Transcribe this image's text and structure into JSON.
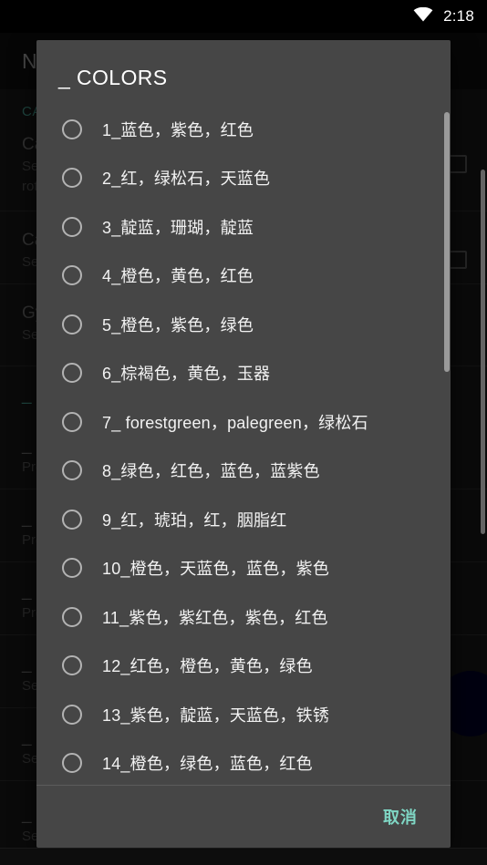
{
  "status_bar": {
    "wifi_icon": "wifi-icon",
    "time": "2:18"
  },
  "background_app": {
    "header_title": "NE",
    "section_title": "CA",
    "scrollbar": "background-scrollbar",
    "fab": "floating-action-button",
    "rows": [
      {
        "title": "Ca",
        "sub": "Set",
        "sub2": "rota",
        "teal": false,
        "checkbox": true
      },
      {
        "title": "Ca",
        "sub": "Set",
        "sub2": "",
        "teal": false,
        "checkbox": true
      },
      {
        "title": "Gy",
        "sub": "Set",
        "sub2": "",
        "teal": false,
        "checkbox": false
      },
      {
        "title": "_ N",
        "sub": "",
        "sub2": "",
        "teal": true,
        "checkbox": false
      },
      {
        "title": "_ C",
        "sub": "Pre",
        "sub2": "",
        "teal": false,
        "checkbox": false
      },
      {
        "title": "_ B",
        "sub": "Pre",
        "sub2": "",
        "teal": false,
        "checkbox": false
      },
      {
        "title": "_ M",
        "sub": "Pre",
        "sub2": "",
        "teal": false,
        "checkbox": false
      },
      {
        "title": "_ B",
        "sub": "Set",
        "sub2": "",
        "teal": false,
        "checkbox": false
      },
      {
        "title": "_ S",
        "sub": "Set",
        "sub2": "",
        "teal": false,
        "checkbox": false
      },
      {
        "title": "_ R",
        "sub": "Set",
        "sub2": "",
        "teal": false,
        "checkbox": false
      }
    ]
  },
  "dialog": {
    "title": "_ COLORS",
    "options": [
      {
        "label": "1_蓝色，紫色，红色",
        "selected": false
      },
      {
        "label": "2_红，绿松石，天蓝色",
        "selected": false
      },
      {
        "label": "3_靛蓝，珊瑚，靛蓝",
        "selected": false
      },
      {
        "label": "4_橙色，黄色，红色",
        "selected": false
      },
      {
        "label": "5_橙色，紫色，绿色",
        "selected": false
      },
      {
        "label": "6_棕褐色，黄色，玉器",
        "selected": false
      },
      {
        "label": "7_ forestgreen，palegreen，绿松石",
        "selected": false
      },
      {
        "label": "8_绿色，红色，蓝色，蓝紫色",
        "selected": false
      },
      {
        "label": "9_红，琥珀，红，胭脂红",
        "selected": false
      },
      {
        "label": "10_橙色，天蓝色，蓝色，紫色",
        "selected": false
      },
      {
        "label": "11_紫色，紫红色，紫色，红色",
        "selected": false
      },
      {
        "label": "12_红色，橙色，黄色，绿色",
        "selected": false
      },
      {
        "label": "13_紫色，靛蓝，天蓝色，铁锈",
        "selected": false
      },
      {
        "label": "14_橙色，绿色，蓝色，红色",
        "selected": false
      }
    ],
    "cancel_label": "取消",
    "scrollbar": "dialog-list-scrollbar"
  },
  "colors": {
    "dialog_surface": "#464646",
    "accent_teal": "#7fd6c4",
    "section_teal": "#2f6b62",
    "text_primary": "#f2f2f2",
    "scrim": "rgba(0,0,0,0.35)"
  }
}
